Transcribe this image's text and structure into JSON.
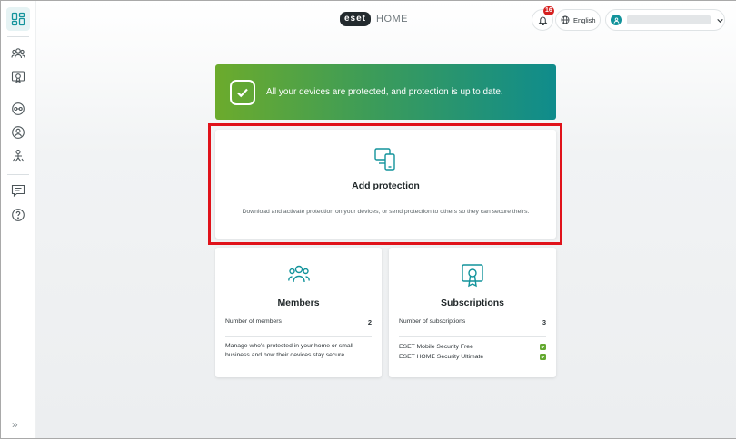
{
  "header": {
    "logo_text": "eset",
    "logo_suffix": "HOME",
    "notification_count": "16",
    "language": "English"
  },
  "banner": {
    "text": "All your devices are protected, and protection is up to date."
  },
  "add_protection": {
    "title": "Add protection",
    "description": "Download and activate protection on your devices, or send protection to others so they can secure theirs."
  },
  "members": {
    "title": "Members",
    "count_label": "Number of members",
    "count_value": "2",
    "description": "Manage who's protected in your home or small business and how their devices stay secure."
  },
  "subscriptions": {
    "title": "Subscriptions",
    "count_label": "Number of subscriptions",
    "count_value": "3",
    "items": [
      {
        "name": "ESET Mobile Security Free",
        "status": "active"
      },
      {
        "name": "ESET HOME Security Ultimate",
        "status": "active"
      }
    ]
  },
  "sidebar": {
    "items": [
      {
        "icon": "dashboard-icon",
        "active": true
      },
      {
        "icon": "members-icon"
      },
      {
        "icon": "subscriptions-icon"
      },
      {
        "icon": "devices-icon"
      },
      {
        "icon": "anti-theft-icon"
      },
      {
        "icon": "family-icon"
      },
      {
        "icon": "feedback-icon"
      },
      {
        "icon": "help-icon"
      }
    ],
    "collapse_glyph": "»"
  },
  "colors": {
    "accent": "#12939b",
    "banner_start": "#6cab2c",
    "banner_end": "#0f8c8c",
    "highlight": "#e0121a",
    "status_ok": "#63a830",
    "badge": "#d6201f"
  }
}
